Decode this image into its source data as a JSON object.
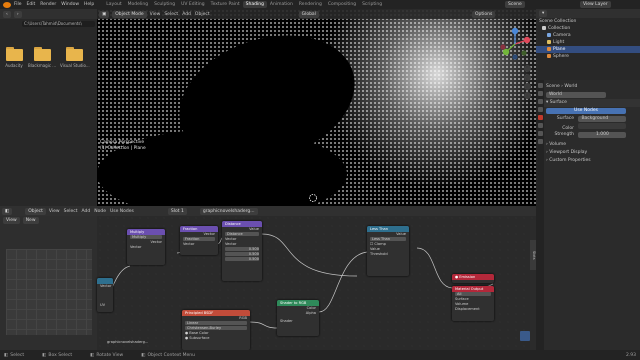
{
  "topbar": {
    "menu": [
      "File",
      "Edit",
      "Render",
      "Window",
      "Help"
    ],
    "workspaces": [
      "Layout",
      "Modeling",
      "Sculpting",
      "UV Editing",
      "Texture Paint",
      "Shading",
      "Animation",
      "Rendering",
      "Compositing",
      "Scripting"
    ],
    "active_workspace": "Shading",
    "scene": "Scene",
    "view_layer": "View Layer"
  },
  "filebrowser": {
    "path": "C:\\Users\\Tahmid\\Documents\\",
    "folders": [
      "Audacity",
      "Blackmagic ...",
      "Visual Studio..."
    ]
  },
  "viewport": {
    "mode": "Object Mode",
    "menus": [
      "View",
      "Select",
      "Add",
      "Object"
    ],
    "transform": "Global",
    "options": "Options",
    "info_line1": "Camera Perspective",
    "info_line2": "(1) Collection | Plane"
  },
  "outliner": {
    "title": "Scene Collection",
    "items": [
      {
        "label": "Collection",
        "color": "#cccccc"
      },
      {
        "label": "Camera",
        "color": "#7aa6e0"
      },
      {
        "label": "Light",
        "color": "#e0c060"
      },
      {
        "label": "Plane",
        "color": "#e08a3a"
      },
      {
        "label": "Sphere",
        "color": "#e08a3a"
      }
    ]
  },
  "properties": {
    "scene_label": "Scene",
    "world_label": "World",
    "world_name": "World",
    "surface_header": "Surface",
    "use_nodes": "Use Nodes",
    "surface_label": "Surface",
    "surface_value": "Background",
    "color_label": "Color",
    "strength_label": "Strength",
    "strength_value": "1.000",
    "sections": [
      "Volume",
      "Viewport Display",
      "Custom Properties"
    ]
  },
  "nodeeditor": {
    "menus": [
      "Object",
      "View",
      "Select",
      "Add",
      "Node"
    ],
    "use_nodes": "Use Nodes",
    "slot": "Slot 1",
    "material": "graphicnovelshaderg...",
    "nodes": {
      "multiply": {
        "title": "Multiply",
        "op": "Multiply",
        "in": "Vector",
        "out": "Vector"
      },
      "fraction": {
        "title": "Fraction",
        "op": "Fraction",
        "in": "Vector",
        "out": "Vector"
      },
      "distance": {
        "title": "Distance",
        "op": "Distance",
        "out": "Value",
        "in1": "Vector",
        "in2": "Vector",
        "vals": [
          "0.500",
          "0.500",
          "0.500"
        ]
      },
      "texcoord": {
        "label": "Vector",
        "sub": "UV"
      },
      "image": {
        "title": "Principled BSDF",
        "filename": "graphicnovelshaderg...",
        "out1": "Color",
        "out2": "Alpha",
        "rgb": "RGB",
        "interp": "Linear",
        "colorspace": "Christensen-Burley",
        "base": "Base Color",
        "subsurface": "Subsurface"
      },
      "shader_rgb": {
        "title": "Shader to RGB",
        "out1": "Color",
        "out2": "Alpha",
        "in": "Shader"
      },
      "greater": {
        "title": "Less Than",
        "op": "Less Than",
        "clamp": "Clamp",
        "out": "Value",
        "in1": "Value",
        "in2": "Threshold"
      },
      "emission": {
        "title": "Emission"
      },
      "output": {
        "title": "Material Output",
        "target": "All",
        "s1": "Surface",
        "s2": "Volume",
        "s3": "Displacement"
      }
    },
    "left_menu": "View",
    "left_new": "New",
    "side_label": "Slots"
  },
  "statusbar": {
    "select": "Select",
    "box_select": "Box Select",
    "rotate_view": "Rotate View",
    "context": "Object Context Menu",
    "version": "2.93"
  }
}
